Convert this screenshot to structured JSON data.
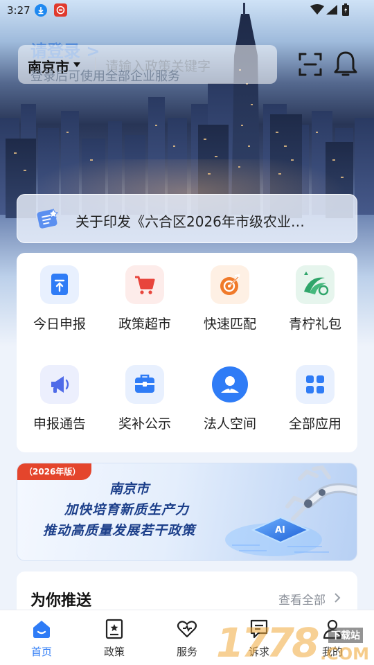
{
  "status_bar": {
    "time": "3:27"
  },
  "header": {
    "login_title": "请登录 >",
    "login_subtitle": "登录后可使用全部企业服务",
    "city": "南京市",
    "search_placeholder": "请输入政策关键字"
  },
  "notice": {
    "text": "关于印发《六合区2026年市级农业…"
  },
  "services": [
    {
      "label": "今日申报",
      "icon": "upload-document-icon",
      "color": "#2f7cf6"
    },
    {
      "label": "政策超市",
      "icon": "shopping-cart-icon",
      "color": "#e8453c"
    },
    {
      "label": "快速匹配",
      "icon": "target-icon",
      "color": "#f07a2a"
    },
    {
      "label": "青柠礼包",
      "icon": "lemon-logo-icon",
      "color": "#2fa56a"
    },
    {
      "label": "申报通告",
      "icon": "megaphone-icon",
      "color": "#4f6be8"
    },
    {
      "label": "奖补公示",
      "icon": "briefcase-icon",
      "color": "#2f7cf6"
    },
    {
      "label": "法人空间",
      "icon": "person-icon",
      "color": "#2f7cf6"
    },
    {
      "label": "全部应用",
      "icon": "grid-apps-icon",
      "color": "#2f7cf6"
    }
  ],
  "banner": {
    "tag": "（2026年版）",
    "line1": "南京市",
    "line2": "加快培育新质生产力",
    "line3": "推动高质量发展若干政策",
    "chip_text": "AI"
  },
  "recommend": {
    "title": "为你推送",
    "more": "查看全部"
  },
  "tabs": [
    {
      "label": "首页",
      "icon": "home-icon",
      "active": true
    },
    {
      "label": "政策",
      "icon": "policy-book-icon",
      "active": false
    },
    {
      "label": "服务",
      "icon": "heart-icon",
      "active": false
    },
    {
      "label": "诉求",
      "icon": "message-icon",
      "active": false
    },
    {
      "label": "我的",
      "icon": "user-icon",
      "active": false
    }
  ],
  "watermark": {
    "number": "1778",
    "site": "下载站",
    "domain": ".COM"
  }
}
